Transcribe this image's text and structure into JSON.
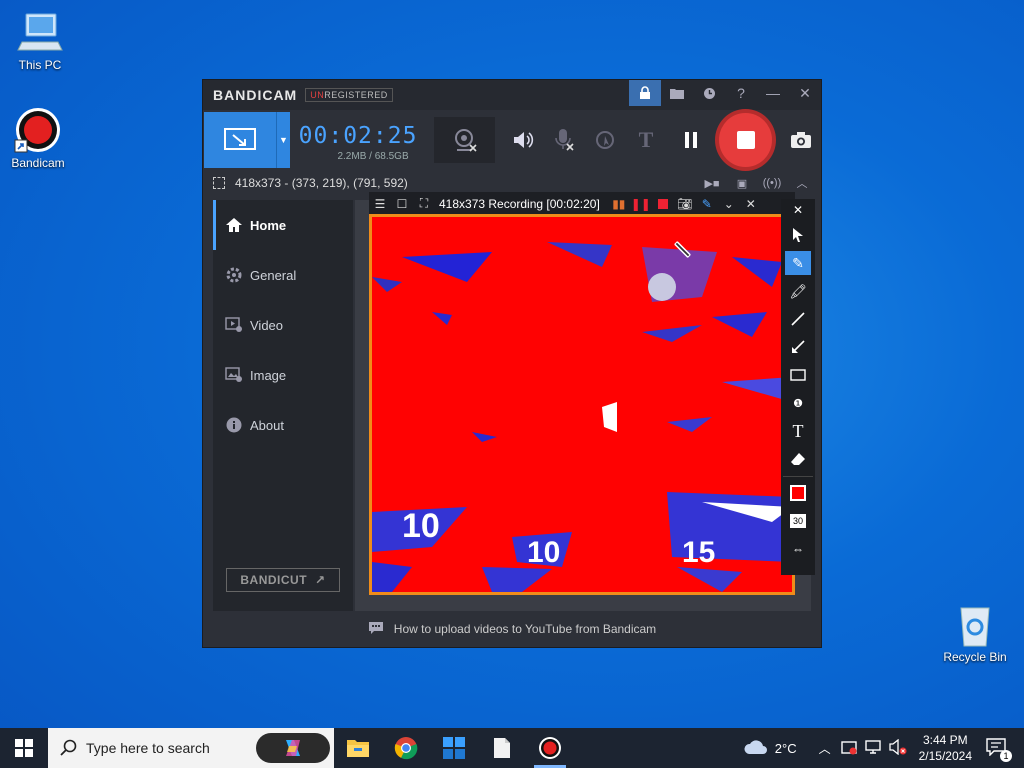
{
  "desktop": {
    "icons": [
      {
        "label": "This PC",
        "icon": "computer-icon"
      },
      {
        "label": "Bandicam",
        "icon": "bandicam-app-icon"
      },
      {
        "label": "Recycle Bin",
        "icon": "recycle-bin-icon"
      }
    ]
  },
  "bandicam": {
    "logo": "BANDICAM",
    "unregistered_prefix": "UN",
    "unregistered_rest": "REGISTERED",
    "timer": "00:02:25",
    "size_info": "2.2MB / 68.5GB",
    "area_info": "418x373 - (373, 219), (791, 592)",
    "nav": [
      {
        "label": "Home",
        "icon": "home-icon",
        "active": true
      },
      {
        "label": "General",
        "icon": "gear-icon",
        "active": false
      },
      {
        "label": "Video",
        "icon": "video-settings-icon",
        "active": false
      },
      {
        "label": "Image",
        "icon": "image-settings-icon",
        "active": false
      },
      {
        "label": "About",
        "icon": "info-icon",
        "active": false
      }
    ],
    "bandicut_label": "BANDICUT",
    "footer_text": "How to upload videos to YouTube from Bandicam",
    "accent_color": "#2f86e0",
    "record_color": "#e63c3c"
  },
  "recording_overlay": {
    "title": "418x373 Recording [00:02:20]",
    "border_color": "#f08c1a",
    "pen_size": "30",
    "pen_color": "#ff0000"
  },
  "taskbar": {
    "search_placeholder": "Type here to search",
    "weather": "2°C",
    "time": "3:44 PM",
    "date": "2/15/2024",
    "notification_count": "1"
  }
}
